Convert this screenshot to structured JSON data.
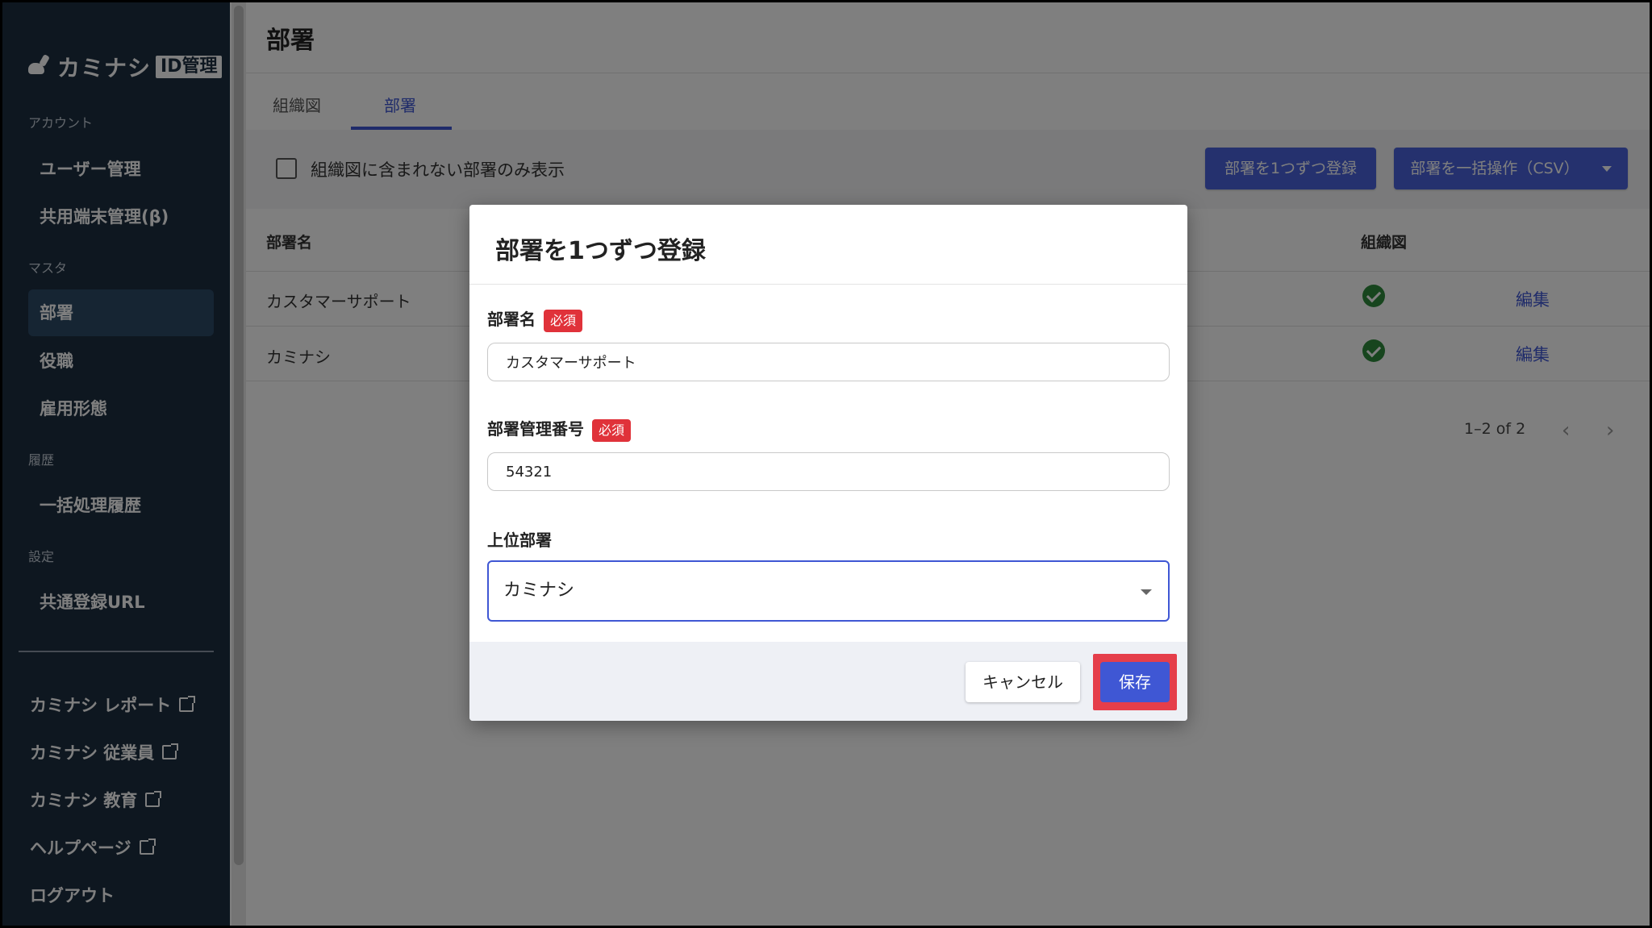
{
  "sidebar": {
    "logo_text": "カミナシ",
    "logo_badge": "ID管理",
    "sections": {
      "account": "アカウント",
      "master": "マスタ",
      "history": "履歴",
      "settings": "設定"
    },
    "items": {
      "users": "ユーザー管理",
      "shared_devices": "共用端末管理(β)",
      "departments": "部署",
      "positions": "役職",
      "employment": "雇用形態",
      "bulk_history": "一括処理履歴",
      "common_url": "共通登録URL"
    },
    "external": {
      "report": "カミナシ レポート",
      "employee": "カミナシ 従業員",
      "education": "カミナシ 教育",
      "help": "ヘルプページ"
    },
    "logout": "ログアウト"
  },
  "header": {
    "title": "部署"
  },
  "tabs": {
    "org_chart": "組織図",
    "departments": "部署"
  },
  "toolbar": {
    "filter_label": "組織図に含まれない部署のみ表示",
    "register_one": "部署を1つずつ登録",
    "bulk_csv": "部署を一括操作（CSV）"
  },
  "table": {
    "headers": {
      "name": "部署名",
      "org_chart": "組織図"
    },
    "rows": [
      {
        "name": "カスタマーサポート",
        "edit": "編集"
      },
      {
        "name": "カミナシ",
        "edit": "編集"
      }
    ],
    "pagination": "1–2 of 2"
  },
  "dialog": {
    "title": "部署を1つずつ登録",
    "required_badge": "必須",
    "dept_name_label": "部署名",
    "dept_name_value": "カスタマーサポート",
    "dept_code_label": "部署管理番号",
    "dept_code_value": "54321",
    "parent_label": "上位部署",
    "parent_value": "カミナシ",
    "cancel": "キャンセル",
    "save": "保存"
  },
  "colors": {
    "sidebar_bg": "#1c2e40",
    "accent": "#3f57d4",
    "required": "#e0323a",
    "success": "#2e8b3c",
    "highlight": "#e53e4a"
  }
}
